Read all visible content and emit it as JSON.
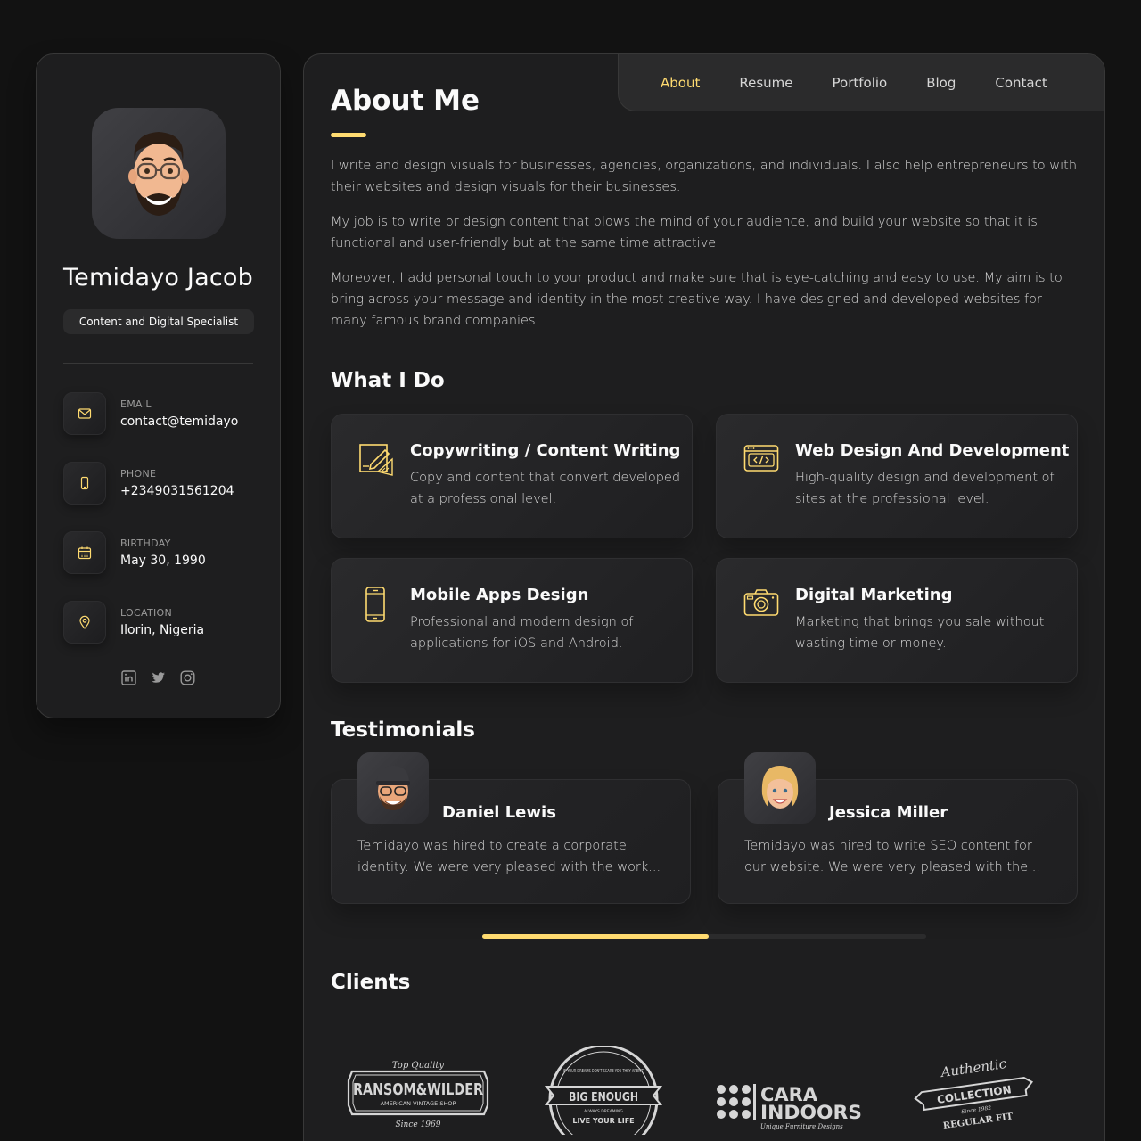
{
  "profile": {
    "name": "Temidayo Jacob",
    "title": "Content and Digital Specialist",
    "contacts": [
      {
        "label": "Email",
        "value": "contact@temidayo"
      },
      {
        "label": "Phone",
        "value": "+2349031561204"
      },
      {
        "label": "Birthday",
        "value": "May 30, 1990"
      },
      {
        "label": "Location",
        "value": "Ilorin, Nigeria"
      }
    ],
    "social_icons": [
      "linkedin-icon",
      "twitter-icon",
      "instagram-icon"
    ]
  },
  "nav": {
    "items": [
      "About",
      "Resume",
      "Portfolio",
      "Blog",
      "Contact"
    ],
    "active": "About"
  },
  "about": {
    "heading": "About Me",
    "paragraphs": [
      "I write and design visuals for businesses, agencies, organizations, and individuals. I also help entrepreneurs to with their websites and design visuals for their businesses.",
      "My job is to write or design content that blows the mind of your audience, and build your website so that it is functional and user-friendly but at the same time attractive.",
      "Moreover, I add personal touch to your product and make sure that is eye-catching and easy to use. My aim is to bring across your message and identity in the most creative way. I have designed and developed websites for many famous brand companies."
    ]
  },
  "services": {
    "heading": "What I Do",
    "items": [
      {
        "title": "Copywriting / Content Writing",
        "text": "Copy and content that convert developed at a professional level.",
        "icon": "pen-design-icon"
      },
      {
        "title": "Web Design And Development",
        "text": "High-quality design and development of sites at the professional level.",
        "icon": "code-browser-icon"
      },
      {
        "title": "Mobile Apps Design",
        "text": "Professional and modern design of applications for iOS and Android.",
        "icon": "smartphone-icon"
      },
      {
        "title": "Digital Marketing",
        "text": "Marketing that brings you sale without wasting time or money.",
        "icon": "camera-icon"
      }
    ]
  },
  "testimonials": {
    "heading": "Testimonials",
    "items": [
      {
        "name": "Daniel Lewis",
        "text": "Temidayo was hired to create a corporate identity. We were very pleased with the work..."
      },
      {
        "name": "Jessica Miller",
        "text": "Temidayo was hired to write SEO content for our website. We were very pleased with the..."
      }
    ],
    "scroll_progress": 0.51
  },
  "clients": {
    "heading": "Clients",
    "logos": [
      {
        "top": "Top Quality",
        "main": "RANSOM&WILDER",
        "sub": "AMERICAN VINTAGE SHOP",
        "bottom": "Since 1969"
      },
      {
        "ring": "IF YOUR DREAMS DON'T SCARE YOU THEY AREN'T",
        "main": "BIG ENOUGH",
        "sub": "ALWAYS DREAMING",
        "bottom": "LIVE YOUR LIFE"
      },
      {
        "main": "CARA",
        "main2": "INDOORS",
        "sub": "Unique Furniture Designs"
      },
      {
        "top": "Authentic",
        "main": "COLLECTION",
        "sub": "Since 1982",
        "bottom": "REGULAR FIT"
      }
    ]
  },
  "colors": {
    "accent": "#ffdb70",
    "background": "#121212",
    "panel": "#1e1e1f",
    "text": "#d6d6d6",
    "heading": "#fafafa"
  }
}
